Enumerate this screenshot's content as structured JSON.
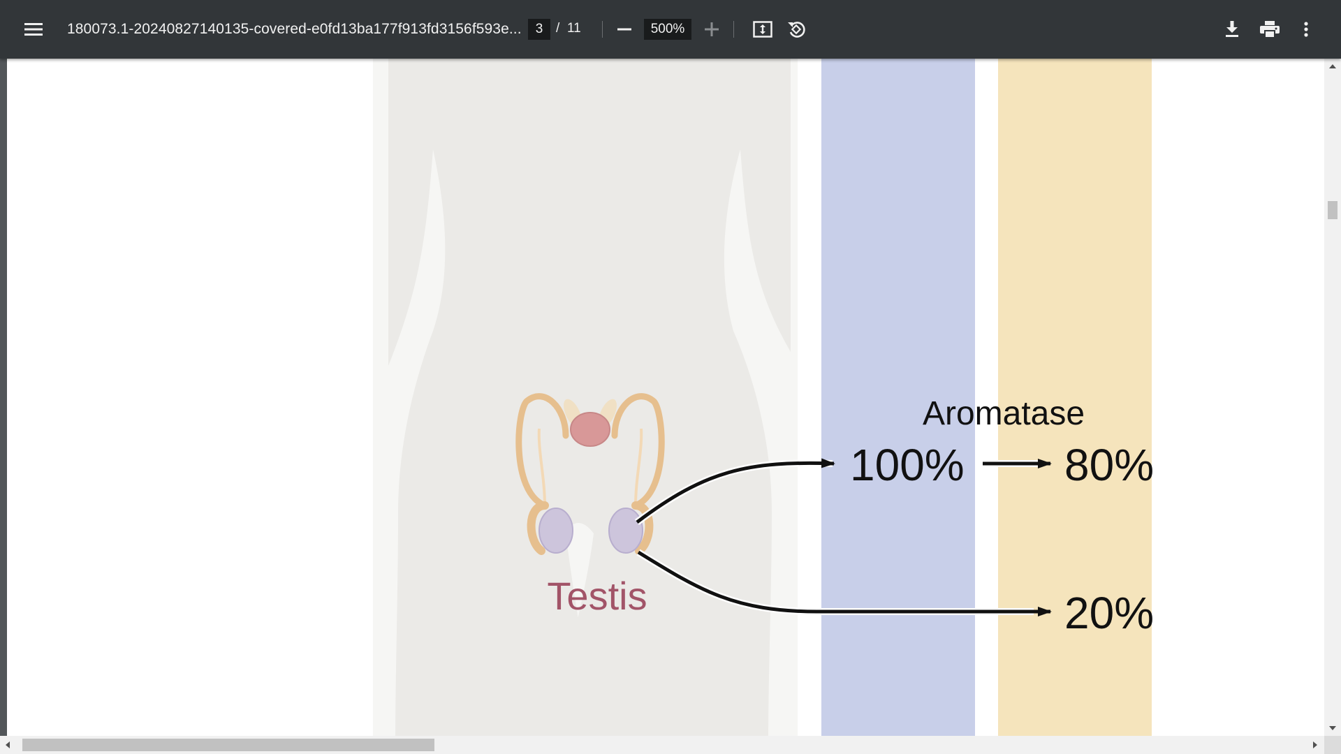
{
  "toolbar": {
    "menu_icon": "hamburger-menu-icon",
    "title": "180073.1-20240827140135-covered-e0fd13ba177f913fd3156f593e...",
    "current_page": "3",
    "page_separator": "/",
    "total_pages": "11",
    "zoom_out_icon": "minus-icon",
    "zoom_level": "500%",
    "zoom_in_icon": "plus-icon",
    "fit_icon": "fit-to-page-icon",
    "rotate_icon": "rotate-counterclockwise-icon",
    "download_icon": "download-icon",
    "print_icon": "print-icon",
    "more_icon": "more-vertical-icon"
  },
  "document": {
    "enzyme_label": "Aromatase",
    "source_label": "Testis",
    "value_top_left": "100%",
    "value_top_right": "80%",
    "value_bottom_right": "20%"
  },
  "colors": {
    "toolbar_bg": "#323639",
    "viewer_bg": "#525659",
    "body_silhouette": "#ebeae7",
    "blue_column": "#c8cfe9",
    "yellow_column": "#f5e4bc",
    "testis_label": "#a25468",
    "organ_outline": "#e6bf8e",
    "testis_fill": "#cdc5dc",
    "prostate_fill": "#d89898"
  }
}
